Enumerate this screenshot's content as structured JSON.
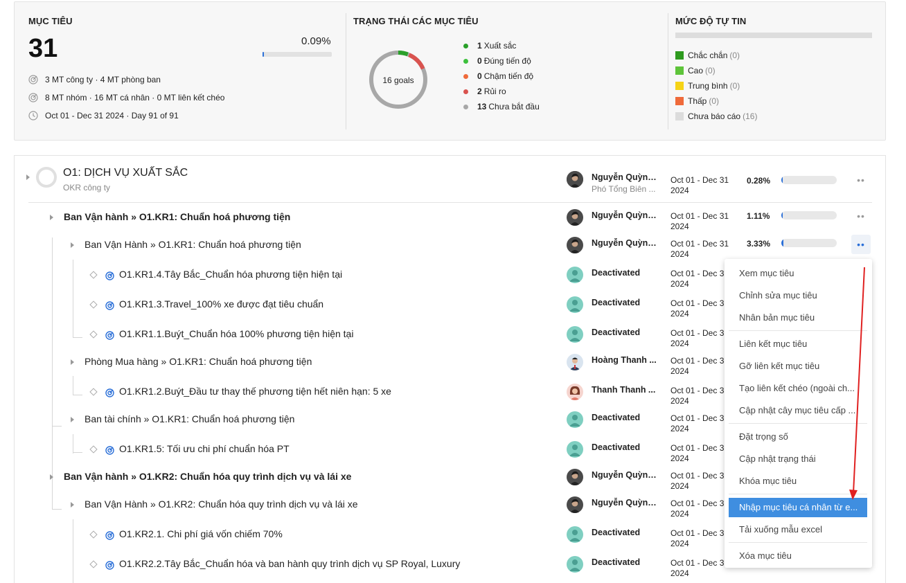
{
  "summary": {
    "objectives": {
      "title": "MỤC TIÊU",
      "count": "31",
      "percent": "0.09%",
      "progress": 0.09,
      "line1": "3 MT công ty · 4 MT phòng ban",
      "line2": "8 MT nhóm · 16 MT cá nhân · 0 MT liên kết chéo",
      "line3": "Oct 01 - Dec 31 2024 · Day 91 of 91"
    },
    "status": {
      "title": "TRẠNG THÁI CÁC MỤC TIÊU",
      "donut_label": "16 goals",
      "items": [
        {
          "count": "1",
          "label": "Xuất sắc",
          "color": "#2aa02a"
        },
        {
          "count": "0",
          "label": "Đúng tiến độ",
          "color": "#3cc03c"
        },
        {
          "count": "0",
          "label": "Chậm tiến độ",
          "color": "#ef6a3a"
        },
        {
          "count": "2",
          "label": "Rủi ro",
          "color": "#d9534f"
        },
        {
          "count": "13",
          "label": "Chưa bắt đầu",
          "color": "#a8a8a8"
        }
      ]
    },
    "confidence": {
      "title": "MỨC ĐỘ TỰ TIN",
      "items": [
        {
          "label": "Chắc chắn",
          "count": "(0)",
          "color": "#2e9a1e"
        },
        {
          "label": "Cao",
          "count": "(0)",
          "color": "#5ec43a"
        },
        {
          "label": "Trung bình",
          "count": "(0)",
          "color": "#f5d316"
        },
        {
          "label": "Thấp",
          "count": "(0)",
          "color": "#ef6a3a"
        },
        {
          "label": "Chưa báo cáo",
          "count": "(16)",
          "color": "#dcdcdc"
        }
      ]
    }
  },
  "list": {
    "objective": {
      "title": "O1: DỊCH VỤ XUẤT SẮC",
      "subtitle": "OKR công ty",
      "owner": "Nguyễn Quỳnh...",
      "owner_role": "Phó Tổng Biên ...",
      "date1": "Oct 01 - Dec 31",
      "date2": "2024",
      "percent": "0.28%",
      "progress": 0.28
    },
    "rows": [
      {
        "prefix": "Ban Vận hành » ",
        "title": "O1.KR1: Chuẩn hoá phương tiện",
        "owner": "Nguyễn Quỳnh...",
        "date1": "Oct 01 - Dec 31",
        "date2": "2024",
        "percent": "1.11%",
        "progress": 1.11
      },
      {
        "prefix": "Ban Vận Hành » ",
        "title": "O1.KR1: Chuẩn hoá phương tiện",
        "owner": "Nguyễn Quỳnh...",
        "date1": "Oct 01 - Dec 31",
        "date2": "2024",
        "percent": "3.33%",
        "progress": 3.33
      },
      {
        "title": "O1.KR1.4.Tây Bắc_Chuẩn hóa phương tiện hiện tại",
        "owner": "Deactivated",
        "date1": "Oct 01 - Dec 31",
        "date2": "2024"
      },
      {
        "title": "O1.KR1.3.Travel_100% xe được đạt tiêu chuẩn",
        "owner": "Deactivated",
        "date1": "Oct 01 - Dec 31",
        "date2": "2024"
      },
      {
        "title": "O1.KR1.1.Buýt_Chuẩn hóa 100% phương tiện hiện tại",
        "owner": "Deactivated",
        "date1": "Oct 01 - Dec 31",
        "date2": "2024"
      },
      {
        "prefix": "Phòng Mua hàng » ",
        "title": "O1.KR1: Chuẩn hoá phương tiện",
        "owner": "Hoàng Thanh ...",
        "date1": "Oct 01 - Dec 31",
        "date2": "2024"
      },
      {
        "title": "O1.KR1.2.Buýt_Đầu tư thay thế phương tiện hết niên hạn: 5 xe",
        "owner": "Thanh Thanh ...",
        "date1": "Oct 01 - Dec 31",
        "date2": "2024"
      },
      {
        "prefix": "Ban tài chính » ",
        "title": "O1.KR1: Chuẩn hoá phương tiện",
        "owner": "Deactivated",
        "date1": "Oct 01 - Dec 31",
        "date2": "2024"
      },
      {
        "title": "O1.KR1.5: Tối ưu chi phí chuẩn hóa PT",
        "owner": "Deactivated",
        "date1": "Oct 01 - Dec 31",
        "date2": "2024"
      },
      {
        "prefix": "Ban Vận hành » ",
        "title": "O1.KR2: Chuẩn hóa quy trình dịch vụ và lái xe",
        "owner": "Nguyễn Quỳnh...",
        "date1": "Oct 01 - Dec 31",
        "date2": "2024"
      },
      {
        "prefix": "Ban Vận Hành » ",
        "title": "O1.KR2: Chuẩn hóa quy trình dịch vụ và lái xe",
        "owner": "Nguyễn Quỳnh...",
        "date1": "Oct 01 - Dec 31",
        "date2": "2024"
      },
      {
        "title": "O1.KR2.1. Chi phí giá vốn chiếm 70%",
        "owner": "Deactivated",
        "date1": "Oct 01 - Dec 31",
        "date2": "2024"
      },
      {
        "title": "O1.KR2.2.Tây Bắc_Chuẩn hóa và ban hành quy trình dịch vụ SP Royal, Luxury",
        "owner": "Deactivated",
        "date1": "Oct 01 - Dec 31",
        "date2": "2024"
      }
    ]
  },
  "menu": {
    "items": [
      "Xem mục tiêu",
      "Chỉnh sửa mục tiêu",
      "Nhân bản mục tiêu",
      "Liên kết mục tiêu",
      "Gỡ liên kết mục tiêu",
      "Tạo liên kết chéo (ngoài ch...",
      "Cập nhật cây mục tiêu cấp ...",
      "Đặt trọng số",
      "Cập nhật trạng thái",
      "Khóa mục tiêu",
      "Nhập mục tiêu cá nhân từ e...",
      "Tải xuống mẫu excel",
      "Xóa mục tiêu"
    ]
  },
  "colors": {
    "accent": "#2a6fd8",
    "menu_selected": "#3f8ee0",
    "annotation_arrow": "#e02020"
  }
}
